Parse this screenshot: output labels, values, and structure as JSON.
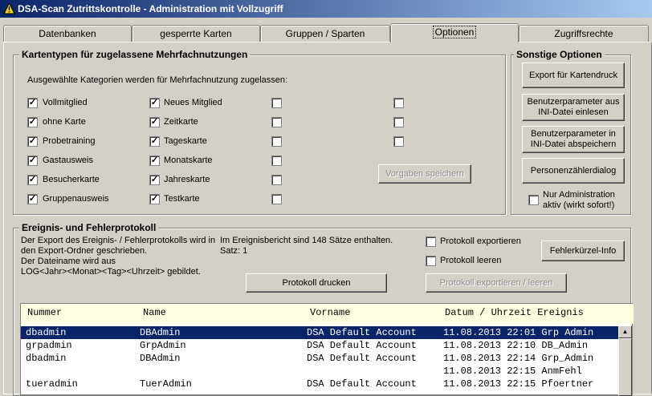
{
  "window": {
    "title": "DSA-Scan Zutrittskontrolle - Administration mit Vollzugriff",
    "app_icon": "warning-triangle-icon"
  },
  "tabs": [
    {
      "label": "Datenbanken"
    },
    {
      "label": "gesperrte Karten"
    },
    {
      "label": "Gruppen / Sparten"
    },
    {
      "label": "Optionen"
    },
    {
      "label": "Zugriffsrechte"
    }
  ],
  "kartentypen": {
    "title": "Kartentypen für zugelassene Mehrfachnutzungen",
    "description": "Ausgewählte Kategorien werden für Mehrfachnutzung zugelassen:",
    "col1": [
      {
        "label": "Vollmitglied",
        "checked": true
      },
      {
        "label": "ohne Karte",
        "checked": true
      },
      {
        "label": "Probetraining",
        "checked": true
      },
      {
        "label": "Gastausweis",
        "checked": true
      },
      {
        "label": "Besucherkarte",
        "checked": true
      },
      {
        "label": "Gruppenausweis",
        "checked": true
      }
    ],
    "col2": [
      {
        "label": "Neues Mitglied",
        "checked": true
      },
      {
        "label": "Zeitkarte",
        "checked": true
      },
      {
        "label": "Tageskarte",
        "checked": true
      },
      {
        "label": "Monatskarte",
        "checked": true
      },
      {
        "label": "Jahreskarte",
        "checked": true
      },
      {
        "label": "Testkarte",
        "checked": true
      }
    ],
    "save_button": "Vorgaben speichern"
  },
  "sonstige": {
    "title": "Sonstige Optionen",
    "export_button": "Export für Kartendruck",
    "load_button_line1": "Benutzerparameter  aus",
    "load_button_line2": "INI-Datei einlesen",
    "save_button_line1": "Benutzerparameter in",
    "save_button_line2": "INI-Datei abspeichern",
    "counter_button": "Personenzählerdialog",
    "admin_only_line1": "Nur Administration",
    "admin_only_line2": "aktiv (wirkt sofort!)",
    "admin_only_checked": false
  },
  "protokoll": {
    "title": "Ereignis- und Fehlerprotokoll",
    "info_line1": "Der Export des Ereignis- / Fehlerprotokolls wird in",
    "info_line2": "den Export-Ordner geschrieben.",
    "info_line3": "Der Dateiname wird aus",
    "info_line4": "LOG<Jahr><Monat><Tag><Uhrzeit> gebildet.",
    "count_text": "Im Ereignisbericht sind 148 Sätze enthalten.",
    "satz_text": "Satz: 1",
    "export_label": "Protokoll exportieren",
    "clear_label": "Protokoll leeren",
    "error_codes_button": "Fehlerkürzel-Info",
    "print_button": "Protokoll drucken",
    "export_clear_button": "Protokoll exportieren / leeren"
  },
  "table": {
    "headers": [
      "Nummer",
      "Name",
      "Vorname",
      "Datum / Uhrzeit Ereignis"
    ],
    "rows": [
      {
        "nummer": "dbadmin",
        "name": "DBAdmin",
        "vorname": "DSA Default Account",
        "datum": "11.08.2013 22:01 Grp Admin"
      },
      {
        "nummer": "grpadmin",
        "name": "GrpAdmin",
        "vorname": "DSA Default Account",
        "datum": "11.08.2013 22:10 DB_Admin"
      },
      {
        "nummer": "dbadmin",
        "name": "DBAdmin",
        "vorname": "DSA Default Account",
        "datum": "11.08.2013 22:14 Grp_Admin"
      },
      {
        "nummer": "",
        "name": "",
        "vorname": "",
        "datum": "11.08.2013 22:15 AnmFehl"
      },
      {
        "nummer": "tueradmin",
        "name": "TuerAdmin",
        "vorname": "DSA Default Account",
        "datum": "11.08.2013 22:15 Pfoertner"
      }
    ]
  }
}
